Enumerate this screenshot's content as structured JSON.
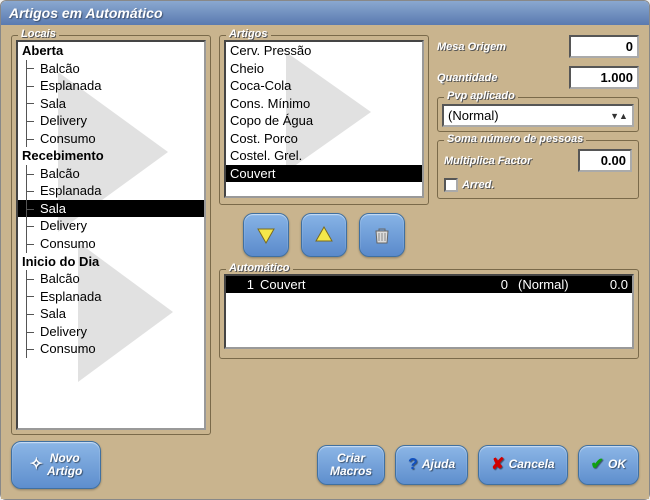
{
  "title": "Artigos em Automático",
  "labels": {
    "locais": "Locais",
    "artigos": "Artigos",
    "mesa_origem": "Mesa Origem",
    "quantidade": "Quantidade",
    "pvp_aplicado": "Pvp aplicado",
    "soma_pessoas": "Soma número de pessoas",
    "multiplica_factor": "Multiplica Factor",
    "arred": "Arred.",
    "automatico": "Automático"
  },
  "locais_tree": [
    {
      "label": "Aberta",
      "root": true
    },
    {
      "label": "Balcão"
    },
    {
      "label": "Esplanada"
    },
    {
      "label": "Sala"
    },
    {
      "label": "Delivery"
    },
    {
      "label": "Consumo"
    },
    {
      "label": "Recebimento",
      "root": true
    },
    {
      "label": "Balcão"
    },
    {
      "label": "Esplanada"
    },
    {
      "label": "Sala",
      "selected": true
    },
    {
      "label": "Delivery"
    },
    {
      "label": "Consumo"
    },
    {
      "label": "Inicio do Dia",
      "root": true
    },
    {
      "label": "Balcão"
    },
    {
      "label": "Esplanada"
    },
    {
      "label": "Sala"
    },
    {
      "label": "Delivery"
    },
    {
      "label": "Consumo"
    }
  ],
  "artigos_list": [
    {
      "label": "Cerv. Pressão"
    },
    {
      "label": "Cheio"
    },
    {
      "label": "Coca-Cola"
    },
    {
      "label": "Cons. Mínimo"
    },
    {
      "label": "Copo de Água"
    },
    {
      "label": "Cost. Porco"
    },
    {
      "label": "Costel. Grel."
    },
    {
      "label": "Couvert",
      "selected": true
    }
  ],
  "fields": {
    "mesa_origem": "0",
    "quantidade": "1.000",
    "pvp_selected": "(Normal)",
    "multiplica_factor": "0.00"
  },
  "auto_rows": [
    {
      "qty": "1",
      "name": "Couvert",
      "col3": "0",
      "pvp": "(Normal)",
      "val": "0.0",
      "selected": true
    }
  ],
  "buttons": {
    "novo_artigo": "Novo\nArtigo",
    "criar_macros": "Criar\nMacros",
    "ajuda": "Ajuda",
    "cancela": "Cancela",
    "ok": "OK"
  }
}
